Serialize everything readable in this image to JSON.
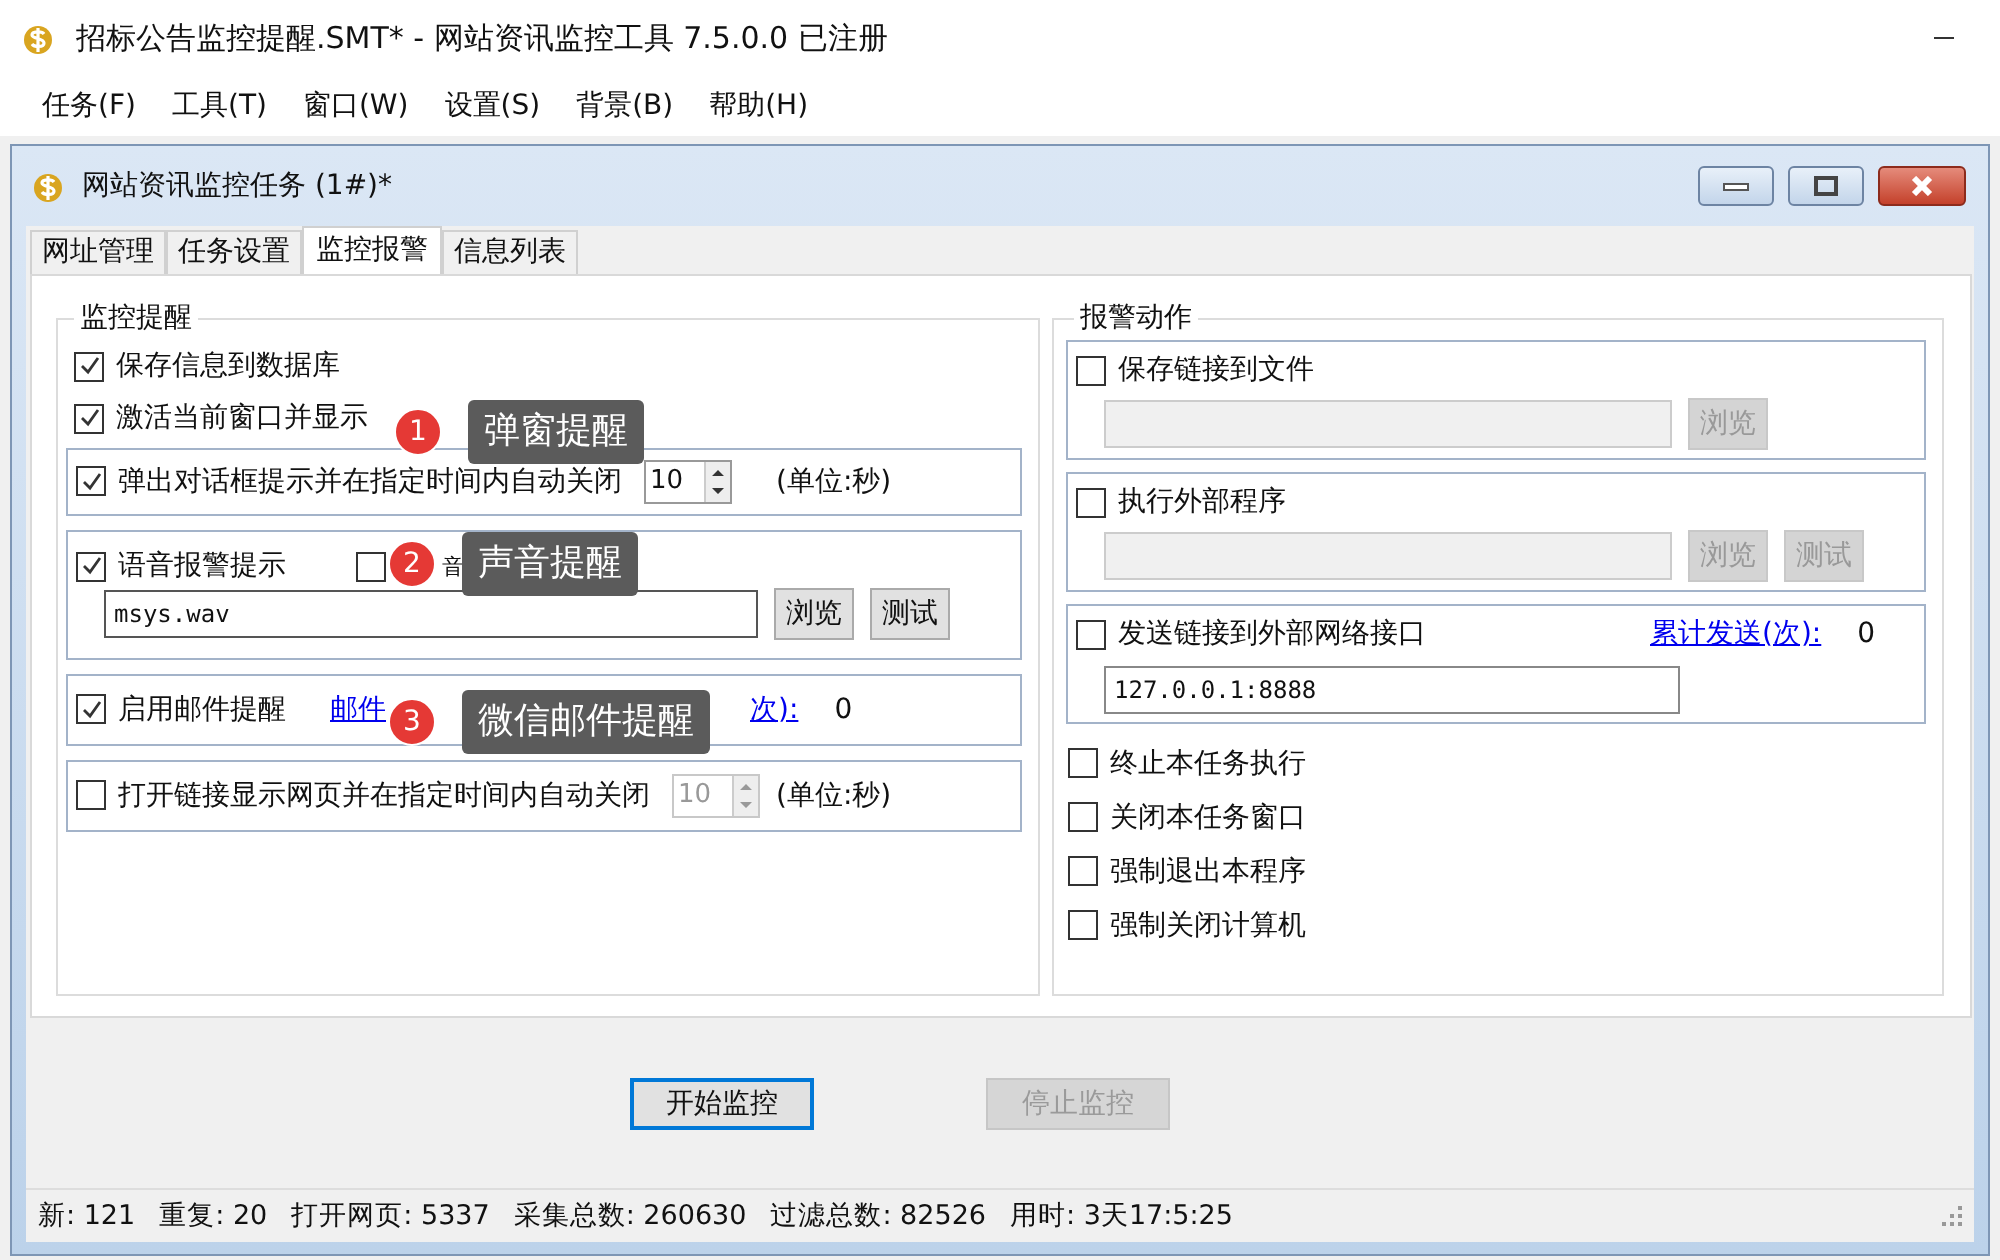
{
  "app": {
    "title": "招标公告监控提醒.SMT* - 网站资讯监控工具 7.5.0.0  已注册"
  },
  "menu": [
    "任务(F)",
    "工具(T)",
    "窗口(W)",
    "设置(S)",
    "背景(B)",
    "帮助(H)"
  ],
  "child": {
    "title": "网站资讯监控任务  (1#)*"
  },
  "tabs": [
    {
      "label": "网址管理",
      "selected": false
    },
    {
      "label": "任务设置",
      "selected": false
    },
    {
      "label": "监控报警",
      "selected": true
    },
    {
      "label": "信息列表",
      "selected": false
    }
  ],
  "monitor": {
    "title": "监控提醒",
    "save_db": {
      "label": "保存信息到数据库",
      "checked": true
    },
    "activate": {
      "label": "激活当前窗口并显示",
      "checked": true
    },
    "popup": {
      "label": "弹出对话框提示并在指定时间内自动关闭",
      "checked": true,
      "value": "10",
      "unit": "(单位:秒)"
    },
    "voice": {
      "label": "语音报警提示",
      "checked": true,
      "loop": {
        "label": "音",
        "checked": false
      },
      "file": "msys.wav",
      "browse": "浏览",
      "test": "测试"
    },
    "mail": {
      "label": "启用邮件提醒",
      "checked": true,
      "link": "邮件",
      "count_link": "次):",
      "count": "0"
    },
    "open_link": {
      "label": "打开链接显示网页并在指定时间内自动关闭",
      "checked": false,
      "value": "10",
      "unit": "(单位:秒)"
    }
  },
  "actions": {
    "title": "报警动作",
    "save_file": {
      "label": "保存链接到文件",
      "checked": false,
      "browse": "浏览"
    },
    "exec": {
      "label": "执行外部程序",
      "checked": false,
      "browse": "浏览",
      "test": "测试"
    },
    "send": {
      "label": "发送链接到外部网络接口",
      "checked": false,
      "link": "累计发送(次):",
      "count": "0",
      "value": "127.0.0.1:8888"
    },
    "options": [
      {
        "label": "终止本任务执行",
        "checked": false
      },
      {
        "label": "关闭本任务窗口",
        "checked": false
      },
      {
        "label": "强制退出本程序",
        "checked": false
      },
      {
        "label": "强制关闭计算机",
        "checked": false
      }
    ]
  },
  "annotations": [
    {
      "number": "1",
      "text": "弹窗提醒"
    },
    {
      "number": "2",
      "text": "声音提醒"
    },
    {
      "number": "3",
      "text": "微信邮件提醒"
    }
  ],
  "buttons": [
    {
      "label": "开始监控",
      "disabled": false
    },
    {
      "label": "停止监控",
      "disabled": true
    }
  ],
  "status": [
    "新: 121",
    "重复: 20",
    "打开网页: 5337",
    "采集总数: 260630",
    "过滤总数: 82526",
    "用时: 3天17:5:25"
  ]
}
